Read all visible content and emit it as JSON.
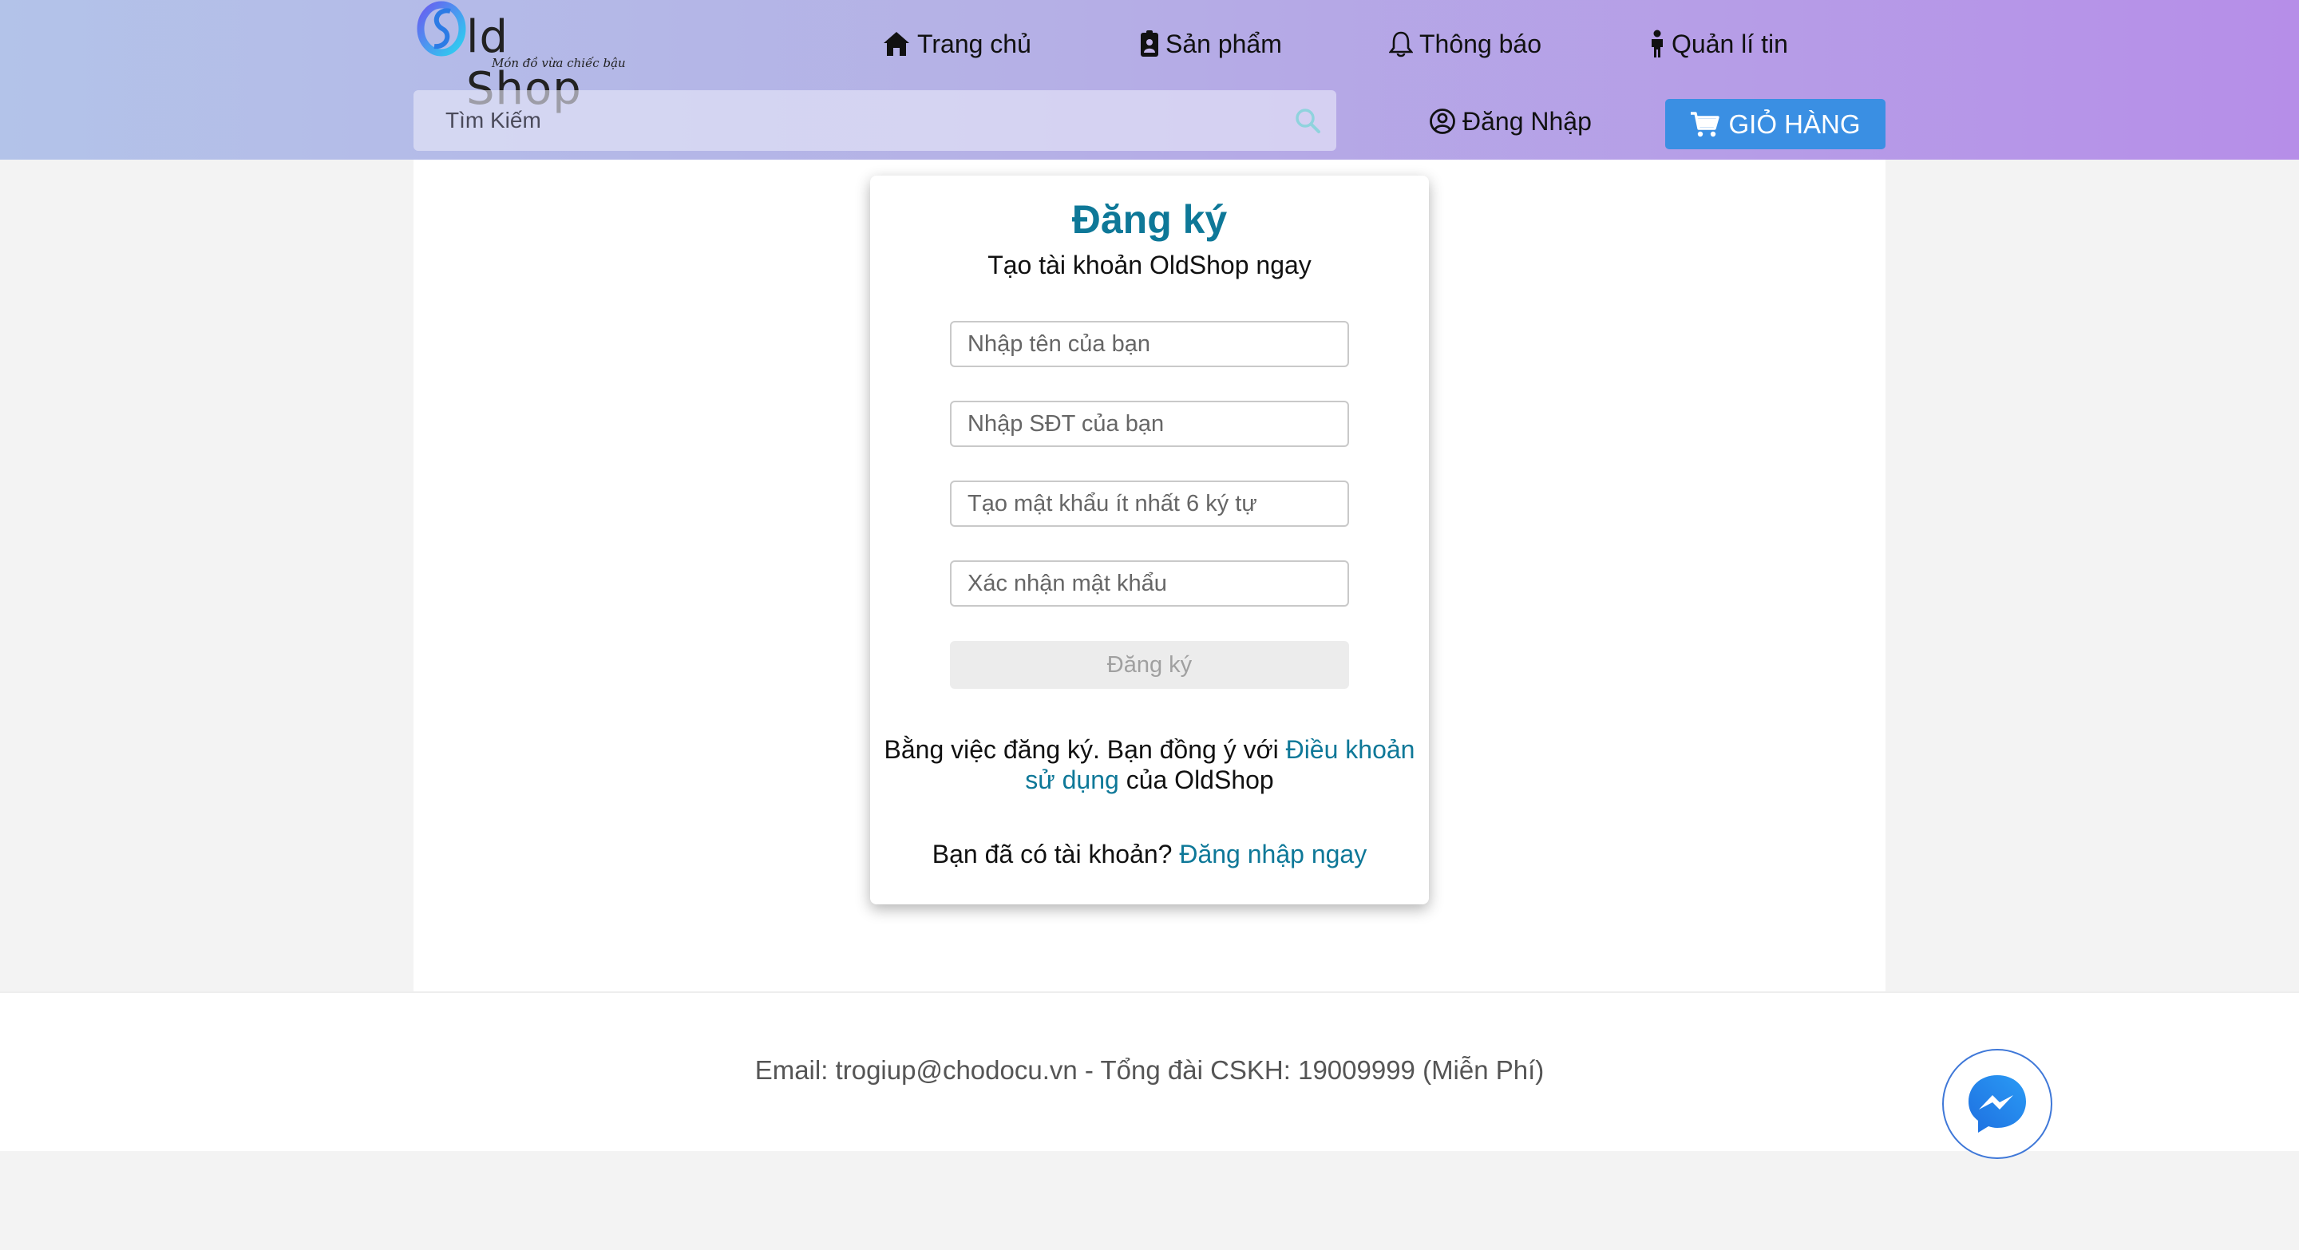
{
  "header": {
    "logo_text": "ld Shop",
    "logo_slogan": "Món đồ vừa chiếc bậu",
    "nav": [
      {
        "label": "Trang chủ",
        "icon": "home-icon"
      },
      {
        "label": "Sản phẩm",
        "icon": "id-badge-icon"
      },
      {
        "label": "Thông báo",
        "icon": "bell-icon"
      },
      {
        "label": "Quản lí tin",
        "icon": "person-icon"
      }
    ],
    "search": {
      "placeholder": "Tìm Kiếm",
      "value": ""
    },
    "login_label": "Đăng Nhập",
    "cart_label": "GIỎ HÀNG",
    "colors": {
      "gradient_start": "#b3c3e9",
      "gradient_end": "#b68ee8",
      "cart_button": "#3a8fe3"
    }
  },
  "register": {
    "title": "Đăng ký",
    "subtitle": "Tạo tài khoản OldShop ngay",
    "fields": {
      "name_placeholder": "Nhập tên của bạn",
      "phone_placeholder": "Nhập SĐT của bạn",
      "password_placeholder": "Tạo mật khẩu ít nhất 6 ký tự",
      "confirm_placeholder": "Xác nhận mật khẩu"
    },
    "submit_label": "Đăng ký",
    "terms_prefix": "Bằng việc đăng ký. Bạn đồng ý với ",
    "terms_link": "Điều khoản sử dụng",
    "terms_suffix": " của OldShop",
    "have_account_text": "Bạn đã có tài khoản? ",
    "login_now_link": "Đăng nhập ngay",
    "accent_color": "#0e7898"
  },
  "footer": {
    "contact": "Email: trogiup@chodocu.vn - Tổng đài CSKH: 19009999 (Miễn Phí)",
    "messenger_icon": "messenger-icon"
  }
}
